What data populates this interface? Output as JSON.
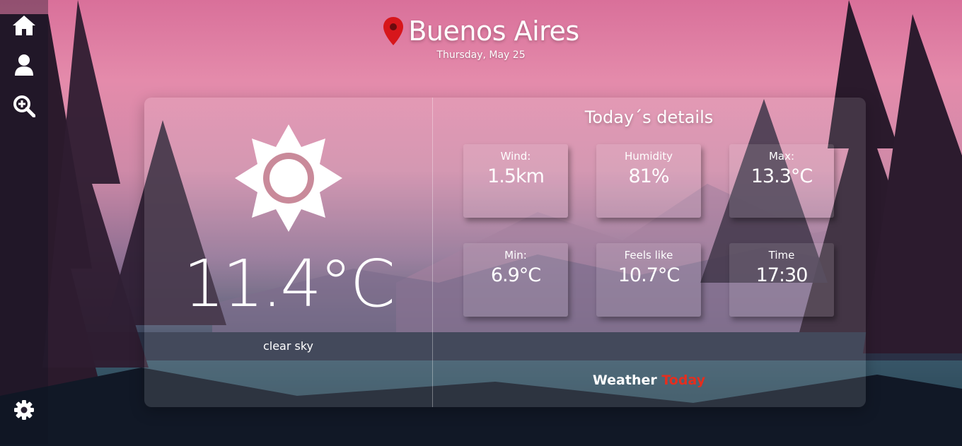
{
  "sidebar": {
    "items": [
      {
        "icon": "home-icon"
      },
      {
        "icon": "user-icon"
      },
      {
        "icon": "search-zoom-icon"
      },
      {
        "icon": "gear-icon"
      }
    ]
  },
  "header": {
    "city": "Buenos Aires",
    "date": "Thursday, May 25",
    "pin_icon": "location-pin-icon",
    "pin_color": "#d7161b"
  },
  "current": {
    "icon": "sun-icon",
    "temperature": "11.4°C",
    "description": "clear sky"
  },
  "details": {
    "title": "Today´s details",
    "cards": [
      {
        "label": "Wind:",
        "value": "1.5km"
      },
      {
        "label": "Humidity",
        "value": "81%"
      },
      {
        "label": "Max:",
        "value": "13.3°C"
      },
      {
        "label": "Min:",
        "value": "6.9°C"
      },
      {
        "label": "Feels like",
        "value": "10.7°C"
      },
      {
        "label": "Time",
        "value": "17:30"
      }
    ]
  },
  "brand": {
    "part1": "Weather",
    "part2": "Today",
    "accent_color": "#e52e1e"
  }
}
